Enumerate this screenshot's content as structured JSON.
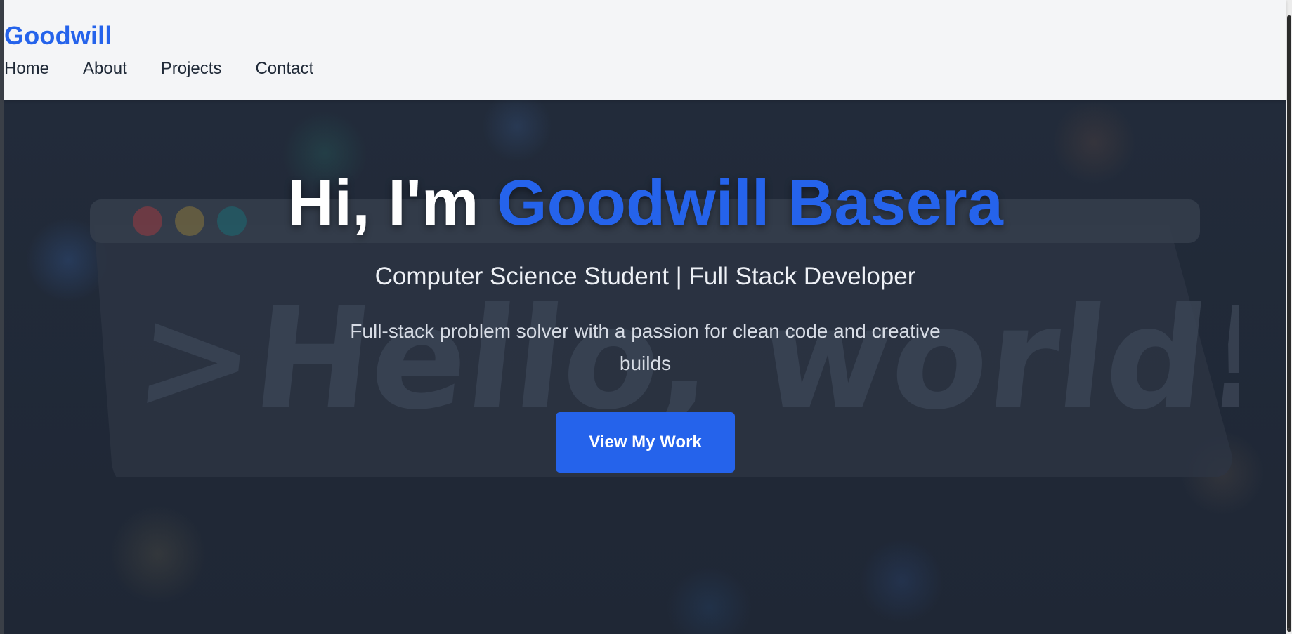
{
  "header": {
    "brand": "Goodwill",
    "nav": [
      {
        "label": "Home"
      },
      {
        "label": "About"
      },
      {
        "label": "Projects"
      },
      {
        "label": "Contact"
      }
    ]
  },
  "hero": {
    "title_prefix": "Hi, I'm ",
    "title_name": "Goodwill Basera",
    "subtitle": "Computer Science Student | Full Stack Developer",
    "description": "Full-stack problem solver with a passion for clean code and creative builds",
    "cta_label": "View My Work",
    "background_text": ">Hello, world!_"
  },
  "colors": {
    "accent": "#2563eb",
    "header_bg": "#f4f5f7",
    "hero_bg": "#1f2735",
    "nav_text": "#1f2937"
  }
}
